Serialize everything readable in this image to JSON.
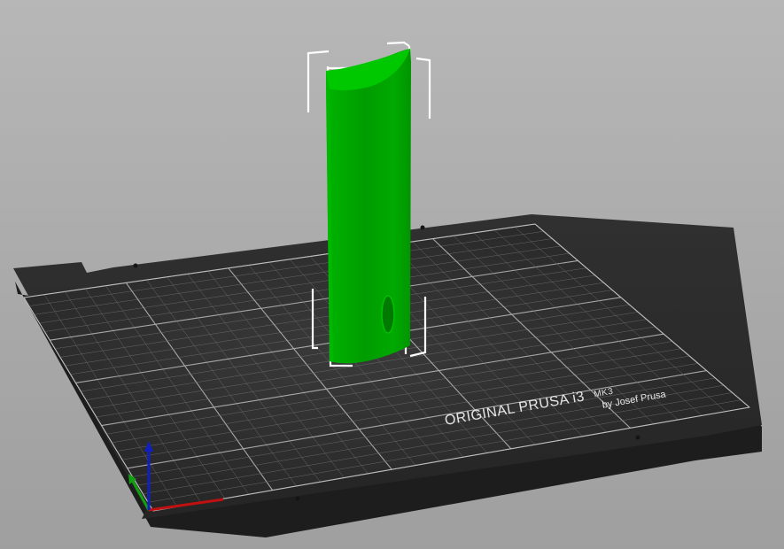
{
  "viewport": {
    "name": "3D plater view",
    "background_color": "#a9a9a9"
  },
  "bed": {
    "logo_line1": "ORIGINAL PRUSA i3",
    "logo_line1_suffix": "MK3",
    "logo_line2": "by Josef Prusa",
    "bed_color": "#2b2b2b",
    "grid_color": "#9a9a9a"
  },
  "model": {
    "color": "#00a800",
    "selected": true,
    "selection_box_color": "#ffffff"
  },
  "axes": {
    "x_color": "#c01010",
    "y_color": "#10a010",
    "z_color": "#1020c0"
  }
}
